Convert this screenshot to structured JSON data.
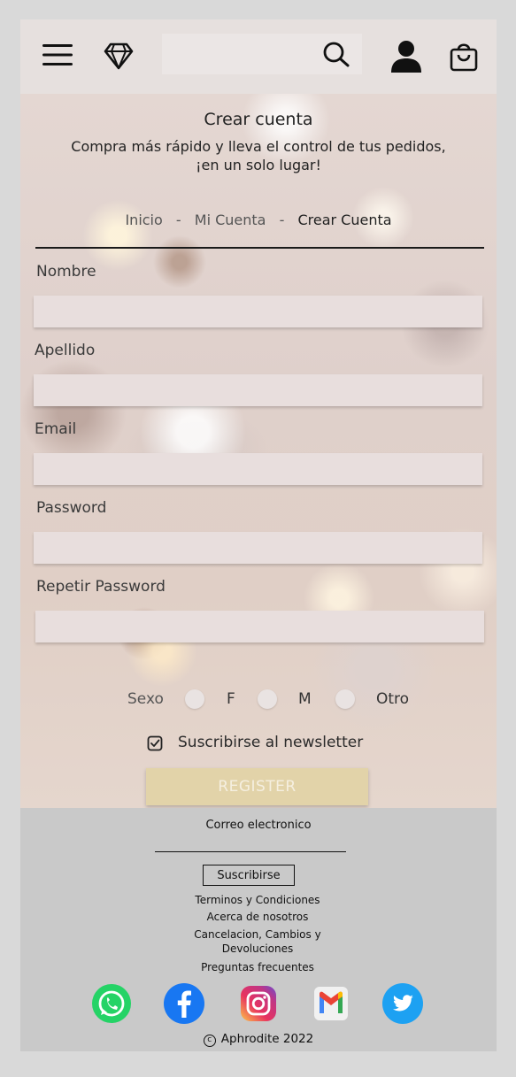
{
  "header": {
    "menu_icon": "hamburger-menu-icon",
    "logo_icon": "diamond-icon",
    "search": {
      "value": "",
      "placeholder": ""
    },
    "search_icon": "search-icon",
    "user_icon": "user-icon",
    "cart_icon": "shopping-bag-icon"
  },
  "main": {
    "title": "Crear cuenta",
    "subtitle": "Compra más rápido y lleva el control de tus pedidos, ¡en un solo lugar!",
    "breadcrumb": [
      {
        "label": "Inicio"
      },
      {
        "label": "Mi Cuenta"
      },
      {
        "label": "Crear Cuenta"
      }
    ],
    "breadcrumb_separator": "-",
    "form": {
      "nombre_label": "Nombre",
      "apellido_label": "Apellido",
      "email_label": "Email",
      "password_label": "Password",
      "repeat_password_label": "Repetir Password",
      "sexo_label": "Sexo",
      "sexo_options": [
        "F",
        "M",
        "Otro"
      ],
      "newsletter_label": "Suscribirse al newsletter",
      "newsletter_checked": true,
      "register_label": "REGISTER"
    }
  },
  "footer": {
    "email_label": "Correo electronico",
    "subscribe_label": "Suscribirse",
    "links": {
      "terms": "Terminos y Condiciones",
      "about": "Acerca de nosotros",
      "cancel": "Cancelacion, Cambios y Devoluciones",
      "faq": "Preguntas frecuentes"
    },
    "social_icons": [
      "whatsapp-icon",
      "facebook-icon",
      "instagram-icon",
      "gmail-icon",
      "twitter-icon"
    ],
    "copyright": "Aphrodite 2022"
  },
  "colors": {
    "header_bg": "#e6e0de",
    "footer_bg": "#c9c9c9",
    "register_bg": "#e2d3a9",
    "input_bg": "#e8dedd"
  }
}
